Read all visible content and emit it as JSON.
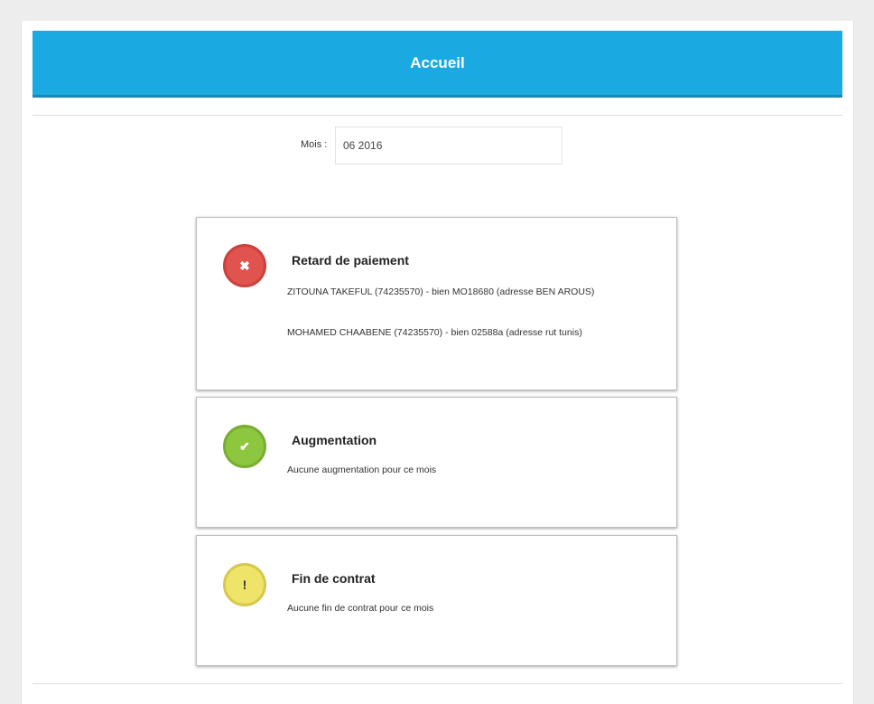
{
  "header": {
    "title": "Accueil"
  },
  "month": {
    "label": "Mois :",
    "value": "06 2016"
  },
  "cards": [
    {
      "title": "Retard de paiement",
      "status": "error",
      "icon": "close-icon",
      "icon_glyph": "✖",
      "color": "#e0534f",
      "lines": [
        "ZITOUNA TAKEFUL (74235570) - bien MO18680 (adresse BEN AROUS)",
        "MOHAMED CHAABENE (74235570) - bien 02588a (adresse rut tunis)"
      ]
    },
    {
      "title": "Augmentation",
      "status": "ok",
      "icon": "check-icon",
      "icon_glyph": "✔",
      "color": "#8dc63f",
      "lines": [
        "Aucune augmentation pour ce mois"
      ]
    },
    {
      "title": "Fin de contrat",
      "status": "warning",
      "icon": "exclamation-icon",
      "icon_glyph": "!",
      "color": "#f0e369",
      "lines": [
        "Aucune fin de contrat pour ce mois"
      ]
    }
  ]
}
